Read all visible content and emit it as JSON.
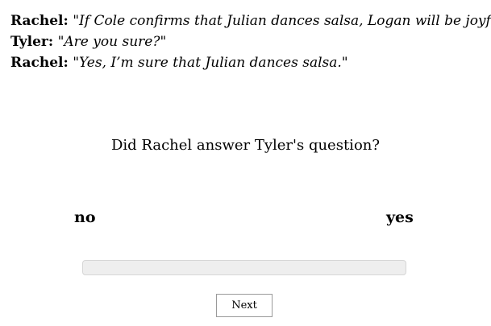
{
  "dialogue": [
    {
      "speaker": "Rachel:",
      "open_quote": " \"",
      "text": "If Cole confirms that Julian dances salsa, Logan will be joyful.",
      "close_quote": "\""
    },
    {
      "speaker": "Tyler:",
      "open_quote": " \"",
      "text": "Are you sure?",
      "close_quote": "\""
    },
    {
      "speaker": "Rachel:",
      "open_quote": " \"",
      "text": "Yes, I’m sure that Julian dances salsa.",
      "close_quote": "\""
    }
  ],
  "question": "Did Rachel answer Tyler's question?",
  "scale": {
    "left_label": "no",
    "right_label": "yes"
  },
  "next_label": "Next",
  "colors": {
    "track_fill": "#eeeeee",
    "track_border": "#d6d6d6",
    "button_border": "#9a9a9a"
  }
}
